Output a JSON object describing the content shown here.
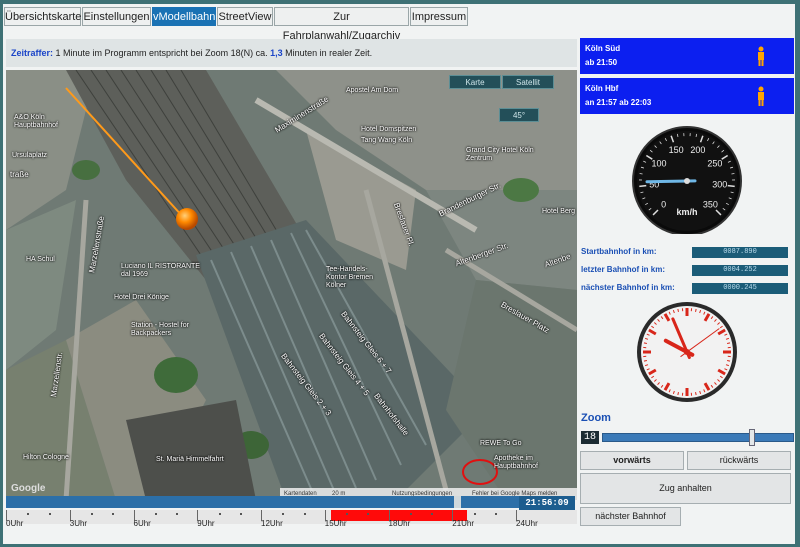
{
  "tabs": [
    {
      "label": "Übersichtskarte",
      "active": false
    },
    {
      "label": "Einstellungen",
      "active": false
    },
    {
      "label": "vModellbahn",
      "active": true
    },
    {
      "label": "StreetView",
      "active": false
    },
    {
      "label": "Zur Fahrplanwahl/Zugarchiv",
      "active": false
    },
    {
      "label": "Impressum",
      "active": false
    }
  ],
  "info": {
    "prefix": "Zeitraffer:",
    "text1": " 1 Minute im Programm entspricht bei Zoom 18(N) ca. ",
    "value": "1,3",
    "text2": " Minuten in realer Zeit."
  },
  "map": {
    "btn_karte": "Karte",
    "btn_satellit": "Satellit",
    "btn_rotate": "45°",
    "labels": {
      "apostel": "Apostel Am Dom",
      "hotel_domspitzen": "Hotel Domspitzen",
      "tang_wang": "Tang Wang Köln",
      "grand_city": "Grand City Hotel Köln Zentrum",
      "ao_koeln": "A&O Köln Hauptbahnhof",
      "ursulaplatz": "Ursulaplatz",
      "ha_schul": "HA Schul",
      "luciano": "Luciano IL RISTORANTE dal 1969",
      "hotel_drei": "Hotel Drei Könige",
      "station_hostel": "Station - Hostel for Backpackers",
      "tee_handels": "Tee-Handels-Kontor Bremen Kölner",
      "hotel_berg": "Hotel Berg",
      "rewe": "REWE To Go",
      "apotheke": "Apotheke im Hauptbahnhof",
      "hilton": "Hilton Cologne",
      "st_mariae": "St. Mariä Himmelfahrt"
    },
    "streets": {
      "maximinen": "Maximinenstraße",
      "marzellen": "Marzellenstraße",
      "marzellen2": "Marzellenstr.",
      "brandenburger": "Brandenburger Str.",
      "breslauer": "Breslauer Pl.",
      "breslauer2": "Breslauer Platz",
      "altenberger": "Altenberger Str.",
      "altenb2": "Altenbe",
      "bahnsteig67": "Bahnsteig Gleis 6 + 7",
      "bahnsteig45": "Bahnsteig Gleis 4 + 5",
      "bahnsteig23": "Bahnsteig Gleis 2 + 3",
      "bahnhofshalle": "Bahnhofshalle",
      "trasse": "traße"
    },
    "footer": {
      "kartendaten": "Kartendaten",
      "scale": "20 m",
      "nutzung": "Nutzungsbedingungen",
      "fehler": "Fehler bei Google Maps melden"
    },
    "google": "Google"
  },
  "timebar": {
    "time": "21:56:09",
    "position_fraction": 0.88,
    "ticks": [
      "0Uhr",
      "3Uhr",
      "6Uhr",
      "9Uhr",
      "12Uhr",
      "15Uhr",
      "18Uhr",
      "21Uhr",
      "24Uhr"
    ],
    "red_start_hour": 15.3,
    "red_end_hour": 21.7
  },
  "trains": [
    {
      "station": "Köln Süd",
      "time": "ab 21:50"
    },
    {
      "station": "Köln Hbf",
      "time": "an 21:57 ab 22:03"
    }
  ],
  "speedo": {
    "ticks": [
      "0",
      "50",
      "100",
      "150",
      "200",
      "250",
      "300",
      "350"
    ],
    "unit": "km/h",
    "value_kmh": 57
  },
  "km": {
    "start_label": "Startbahnhof in km:",
    "start_value": "0087.890",
    "last_label": "letzter Bahnhof in km:",
    "last_value": "0004.252",
    "next_label": "nächster Bahnhof in km:",
    "next_value": "0000.245"
  },
  "analog_clock": {
    "hours": 21,
    "minutes": 56,
    "seconds": 9
  },
  "zoom": {
    "label": "Zoom",
    "value": "18",
    "fraction": 0.78
  },
  "buttons": {
    "forward": "vorwärts",
    "backward": "rückwärts",
    "stop": "Zug anhalten",
    "next_station": "nächster Bahnhof"
  },
  "colors": {
    "accent": "#1a72b4",
    "train_box": "#0c1ff0",
    "red_band": "#ff0a0a"
  }
}
